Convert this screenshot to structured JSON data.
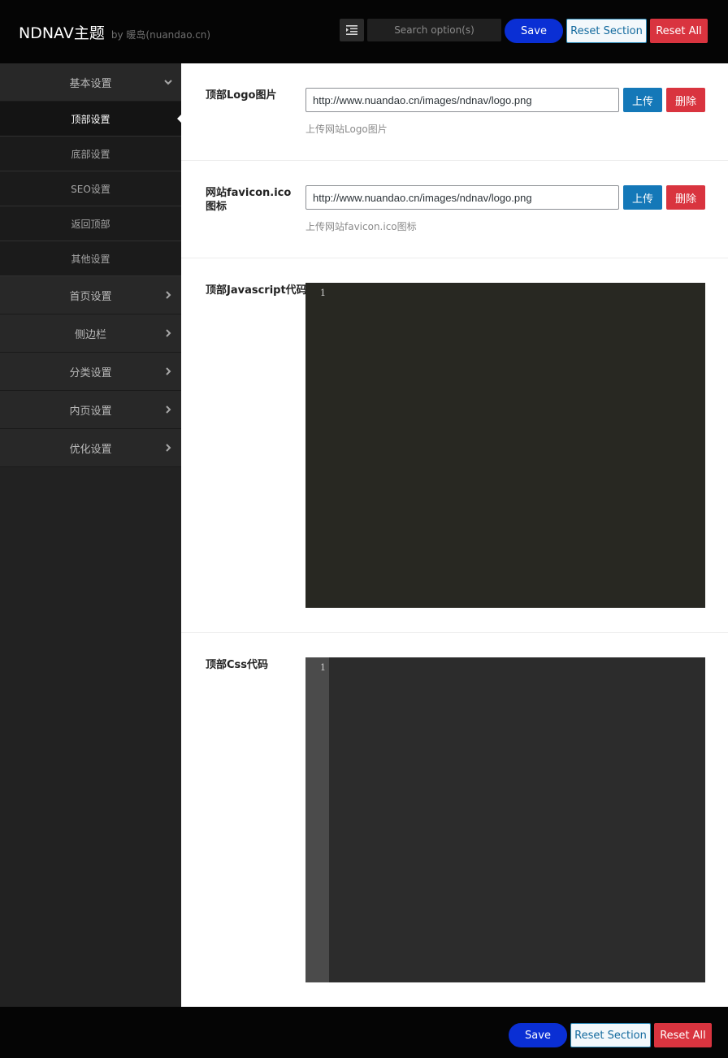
{
  "header": {
    "brand_title": "NDNAV主题",
    "brand_by": "by 暖岛(nuandao.cn)",
    "search_placeholder": "Search option(s)",
    "save_label": "Save",
    "reset_section_label": "Reset Section",
    "reset_all_label": "Reset All"
  },
  "sidebar": {
    "sections": [
      {
        "label": "基本设置",
        "expanded": true
      },
      {
        "label": "首页设置"
      },
      {
        "label": "侧边栏"
      },
      {
        "label": "分类设置"
      },
      {
        "label": "内页设置"
      },
      {
        "label": "优化设置"
      }
    ],
    "subitems": [
      {
        "label": "顶部设置",
        "active": true
      },
      {
        "label": "底部设置"
      },
      {
        "label": "SEO设置"
      },
      {
        "label": "返回顶部"
      },
      {
        "label": "其他设置"
      }
    ]
  },
  "main": {
    "logo": {
      "label": "顶部Logo图片",
      "value": "http://www.nuandao.cn/images/ndnav/logo.png",
      "upload_label": "上传",
      "delete_label": "删除",
      "desc": "上传网站Logo图片"
    },
    "favicon": {
      "label": "网站favicon.ico图标",
      "value": "http://www.nuandao.cn/images/ndnav/logo.png",
      "upload_label": "上传",
      "delete_label": "删除",
      "desc": "上传网站favicon.ico图标"
    },
    "js_code": {
      "label": "顶部Javascript代码",
      "line_number": "1"
    },
    "css_code": {
      "label": "顶部Css代码",
      "line_number": "1"
    }
  },
  "footer": {
    "save_label": "Save",
    "reset_section_label": "Reset Section",
    "reset_all_label": "Reset All"
  },
  "colors": {
    "header_bg": "#050505",
    "sidebar_bg": "#222222",
    "save_blue": "#0a2fd4",
    "upload_blue": "#1478b8",
    "danger_red": "#d9343f"
  }
}
